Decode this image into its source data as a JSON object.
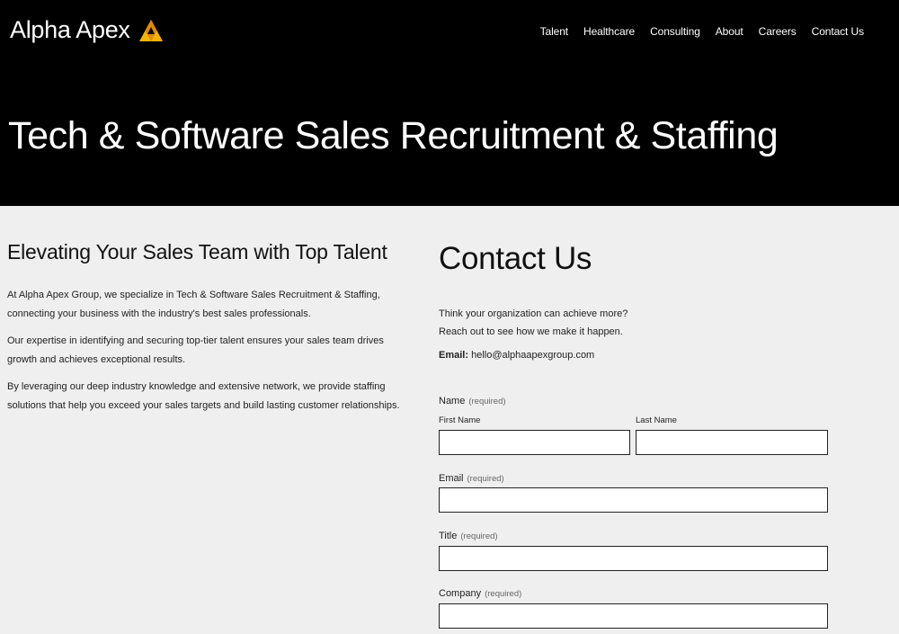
{
  "brand": {
    "name": "Alpha Apex",
    "logo_icon": "triangle-a-logo",
    "accent": "#f5b400"
  },
  "nav": {
    "items": [
      "Talent",
      "Healthcare",
      "Consulting",
      "About",
      "Careers",
      "Contact Us"
    ]
  },
  "hero": {
    "title": "Tech & Software Sales Recruitment & Staffing"
  },
  "about": {
    "heading": "Elevating Your Sales Team with Top Talent",
    "paragraphs": [
      "At Alpha Apex Group, we specialize in Tech & Software Sales Recruitment & Staffing, connecting your business with the industry's best sales professionals.",
      "Our expertise in identifying and securing top-tier talent ensures your sales team drives growth and achieves exceptional results.",
      "By leveraging our deep industry knowledge and extensive network, we provide staffing solutions that help you exceed your sales targets and build lasting customer relationships."
    ]
  },
  "contact": {
    "heading": "Contact Us",
    "intro_line1": "Think your organization can achieve more?",
    "intro_line2": "Reach out to see how we make it happen.",
    "email_label": "Email:",
    "email_value": "hello@alphaapexgroup.com",
    "form": {
      "required_text": "(required)",
      "name_label": "Name",
      "first_name_label": "First Name",
      "last_name_label": "Last Name",
      "first_name_value": "",
      "last_name_value": "",
      "email_label": "Email",
      "email_value": "",
      "title_label": "Title",
      "title_value": "",
      "company_label": "Company",
      "company_value": ""
    }
  }
}
